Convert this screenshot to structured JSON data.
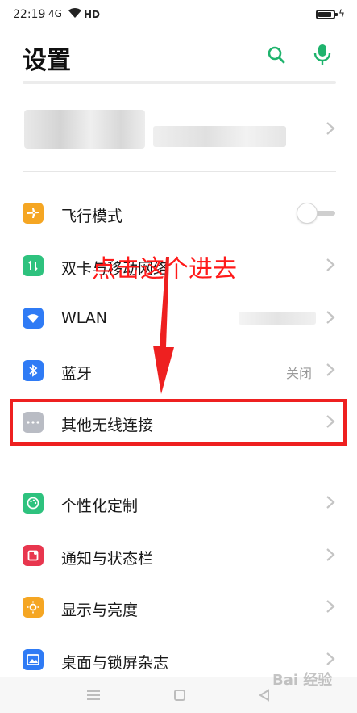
{
  "status_bar": {
    "time": "22:19",
    "signal": "4G",
    "network": "HD"
  },
  "header": {
    "title": "设置"
  },
  "settings": {
    "airplane": {
      "label": "飞行模式",
      "icon": "airplane-icon",
      "color": "#f5a623",
      "toggle": false
    },
    "dual_sim": {
      "label": "双卡与移动网络",
      "icon": "dual-sim-icon",
      "color": "#2ec27e"
    },
    "wlan": {
      "label": "WLAN",
      "icon": "wifi-icon",
      "color": "#2f7bf5"
    },
    "bluetooth": {
      "label": "蓝牙",
      "value": "关闭",
      "icon": "bluetooth-icon",
      "color": "#2f7bf5"
    },
    "other_wireless": {
      "label": "其他无线连接",
      "icon": "more-dots-icon",
      "color": "#b9bcc4"
    },
    "personalize": {
      "label": "个性化定制",
      "icon": "palette-icon",
      "color": "#2ec27e"
    },
    "notification": {
      "label": "通知与状态栏",
      "icon": "notification-icon",
      "color": "#e8364e"
    },
    "display": {
      "label": "显示与亮度",
      "icon": "sun-icon",
      "color": "#f5a623"
    },
    "desktop": {
      "label": "桌面与锁屏杂志",
      "icon": "picture-icon",
      "color": "#2f7bf5"
    }
  },
  "annotation": {
    "text": "点击这个进去",
    "color": "#ee2020"
  },
  "watermark": {
    "text": "Bai 经验"
  }
}
